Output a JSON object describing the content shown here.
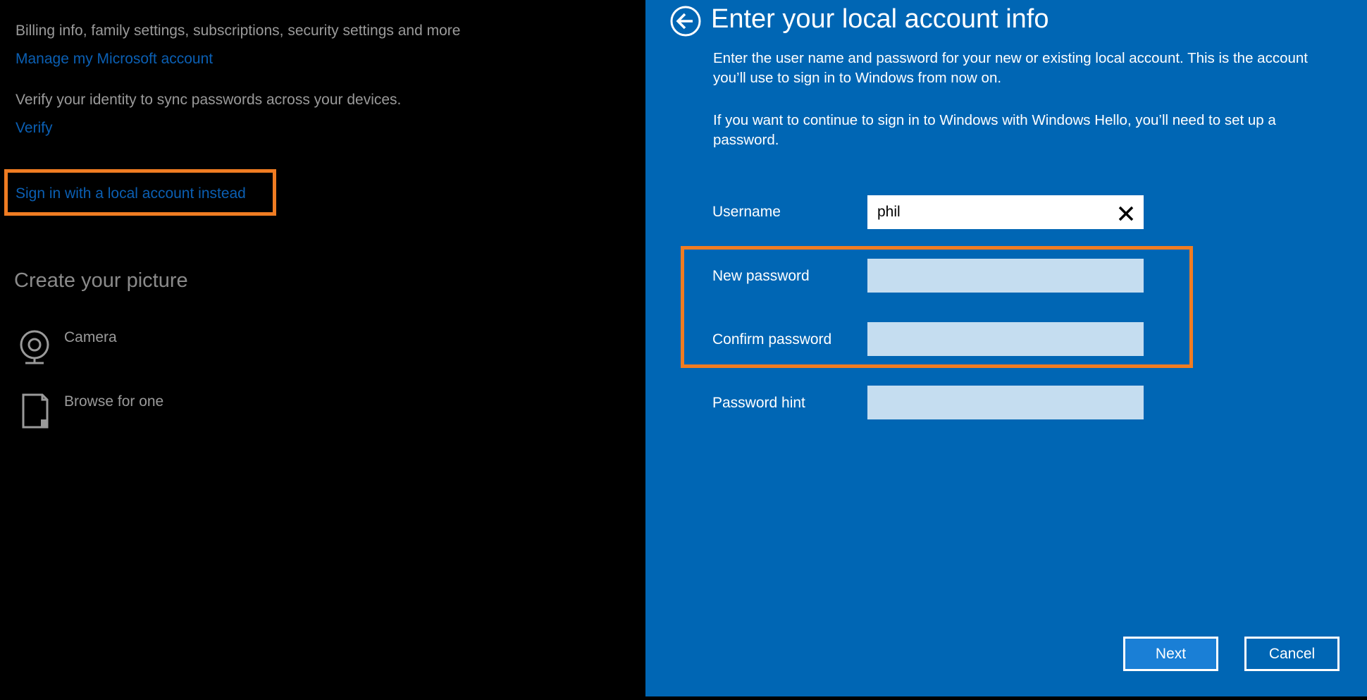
{
  "left_panel": {
    "billing_text": "Billing info, family settings, subscriptions, security settings and more",
    "manage_link": "Manage my Microsoft account",
    "verify_text": "Verify your identity to sync passwords across your devices.",
    "verify_link": "Verify",
    "local_account_link": "Sign in with a local account instead",
    "create_picture_heading": "Create your picture",
    "picture_options": [
      {
        "label": "Camera",
        "icon": "camera-icon"
      },
      {
        "label": "Browse for one",
        "icon": "browse-file-icon"
      }
    ]
  },
  "dialog": {
    "title": "Enter your local account info",
    "back_icon": "back-arrow-icon",
    "paragraph1": "Enter the user name and password for your new or existing local account. This is the account you’ll use to sign in to Windows from now on.",
    "paragraph2": "If you want to continue to sign in to Windows with Windows Hello, you’ll need to set up a password.",
    "fields": {
      "username": {
        "label": "Username",
        "value": "phil"
      },
      "new_password": {
        "label": "New password",
        "value": ""
      },
      "confirm_password": {
        "label": "Confirm password",
        "value": ""
      },
      "password_hint": {
        "label": "Password hint",
        "value": ""
      }
    },
    "buttons": {
      "next": "Next",
      "cancel": "Cancel"
    }
  },
  "colors": {
    "dialog_background": "#0066b4",
    "highlight_outline": "#f07c22",
    "link": "#0b5fb3",
    "empty_field": "#c5ddf0"
  }
}
